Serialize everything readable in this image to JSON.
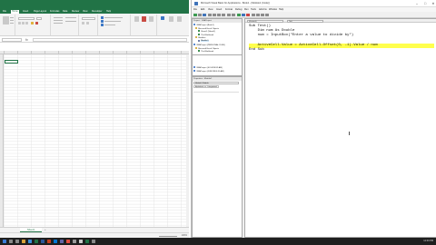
{
  "excel": {
    "tabs": [
      "File",
      "Home",
      "Insert",
      "Page Layout",
      "Formulas",
      "Data",
      "Review",
      "View",
      "Developer",
      "Help"
    ],
    "active_tab": "Home",
    "namebox_value": "",
    "formula_value": "",
    "sheet_tab": "Sheet1",
    "sheet_add": "+",
    "zoom_label": "100%"
  },
  "vba": {
    "title": "Microsoft Visual Basic for Applications - Book1 - [Module1 (Code)]",
    "window_controls": [
      "–",
      "□",
      "✕"
    ],
    "menu": [
      "File",
      "Edit",
      "View",
      "Insert",
      "Format",
      "Debug",
      "Run",
      "Tools",
      "Add-Ins",
      "Window",
      "Help"
    ],
    "project_pane_title": "Project - VBAProject",
    "tree_items": [
      {
        "label": "VBAProject (Book1)",
        "icon": "project-icon",
        "indent": 0
      },
      {
        "label": "Microsoft Excel Objects",
        "icon": "folder-icon",
        "indent": 1
      },
      {
        "label": "Sheet1 (Sheet1)",
        "icon": "sheet-icon",
        "indent": 2
      },
      {
        "label": "ThisWorkbook",
        "icon": "workbook-icon",
        "indent": 2
      },
      {
        "label": "Modules",
        "icon": "folder-icon",
        "indent": 1
      },
      {
        "label": "Module1",
        "icon": "module-icon",
        "indent": 2
      },
      {
        "label": "VBAProject (PERSONAL.XLSB)",
        "icon": "project-icon",
        "indent": 0
      },
      {
        "label": "Microsoft Excel Objects",
        "icon": "folder-icon",
        "indent": 1
      },
      {
        "label": "ThisWorkbook",
        "icon": "workbook-icon",
        "indent": 2
      }
    ],
    "tree_items_2": [
      {
        "label": "VBAProject (SOLVER.XLAM)",
        "icon": "project-icon",
        "indent": 0
      },
      {
        "label": "VBAProject (FUNCRES.XLAM)",
        "icon": "project-icon",
        "indent": 0
      }
    ],
    "props_pane_title": "Properties - Module1",
    "props_object": "Module1 Module",
    "props_tabs": [
      "Alphabetic",
      "Categorized"
    ],
    "code_combo_left": "(General)",
    "code_combo_right": "Test",
    "code_lines": [
      {
        "text": "Sub Test()",
        "highlight": false
      },
      {
        "text": "    Dim num As Double",
        "highlight": false
      },
      {
        "text": "    num = InputBox(\"Enter a value to divide by\")",
        "highlight": false
      },
      {
        "text": "",
        "highlight": false
      },
      {
        "text": "    ActiveCell.Value = ActiveCell.Offset(0, -1).Value / num",
        "highlight": true
      },
      {
        "text": "End Sub",
        "highlight": false
      }
    ]
  },
  "taskbar": {
    "tray_text": "12:00 PM"
  },
  "colors": {
    "excel_green": "#217346",
    "highlight_yellow": "#ffff4d",
    "taskbar": "#1f1f1f"
  }
}
